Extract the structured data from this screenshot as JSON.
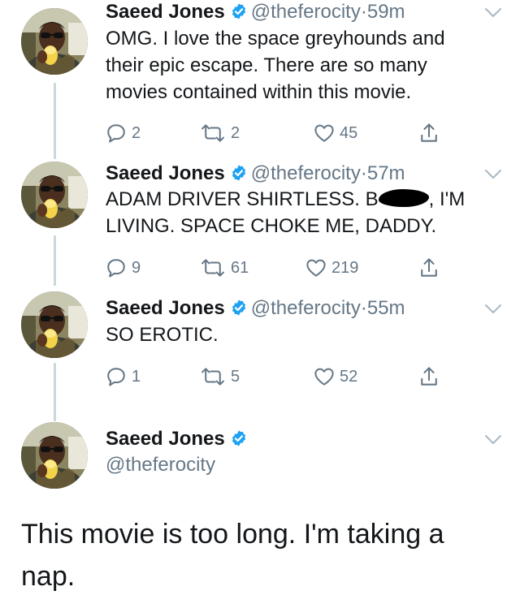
{
  "tweets": [
    {
      "name": "Saeed Jones",
      "handle": "@theferocity",
      "time": "59m",
      "text": "OMG. I love the space greyhounds and their epic escape. There are so many movies contained within this movie.",
      "replies": "2",
      "retweets": "2",
      "likes": "45"
    },
    {
      "name": "Saeed Jones",
      "handle": "@theferocity",
      "time": "57m",
      "text_before": "ADAM DRIVER SHIRTLESS. B",
      "text_after": ", I'M LIVING. SPACE CHOKE ME, DADDY.",
      "replies": "9",
      "retweets": "61",
      "likes": "219"
    },
    {
      "name": "Saeed Jones",
      "handle": "@theferocity",
      "time": "55m",
      "text": "SO EROTIC.",
      "replies": "1",
      "retweets": "5",
      "likes": "52"
    }
  ],
  "focused_tweet": {
    "name": "Saeed Jones",
    "handle": "@theferocity",
    "text": "This movie is too long. I'm taking a nap."
  },
  "separator": "·",
  "colors": {
    "text": "#14171a",
    "secondary": "#657786",
    "verified": "#1da1f2",
    "thread_line": "#ccd6dd"
  },
  "icons": [
    "verified-badge-icon",
    "chevron-down-icon",
    "reply-icon",
    "retweet-icon",
    "like-icon",
    "share-icon"
  ]
}
